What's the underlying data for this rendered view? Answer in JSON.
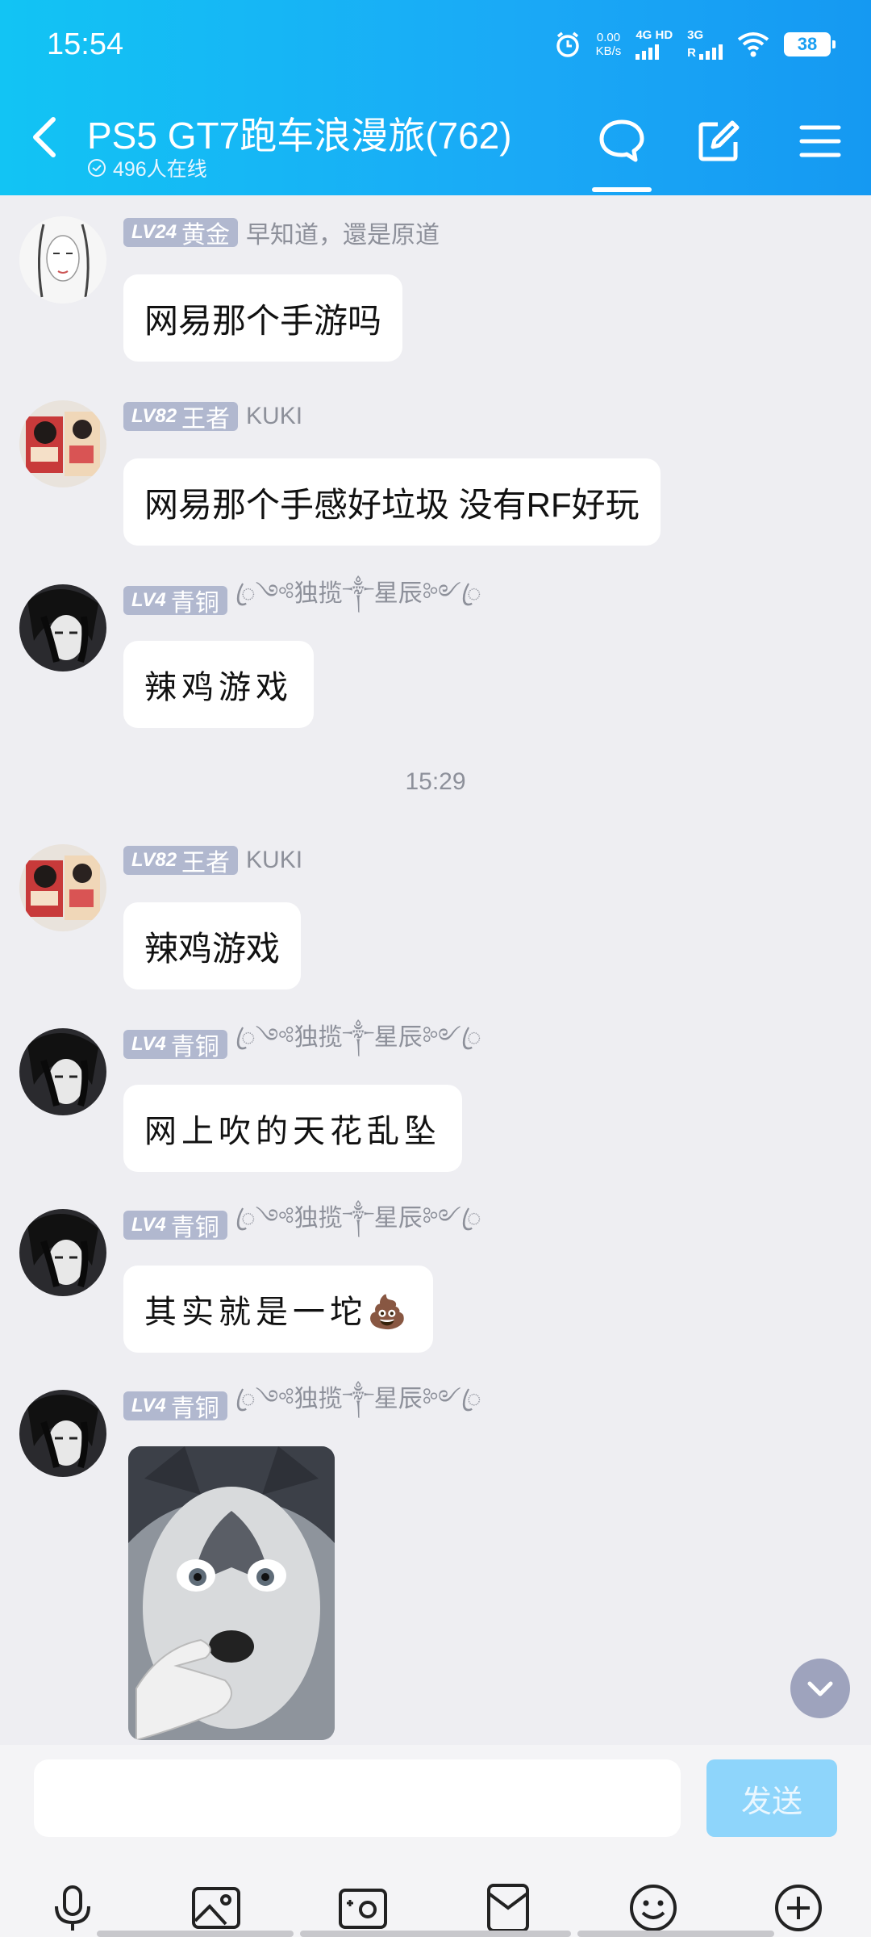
{
  "status_bar": {
    "time": "15:54",
    "net_speed": "0.00",
    "net_unit": "KB/s",
    "sim1": "4G HD",
    "sim2": "3G",
    "sim2_roaming": "R",
    "battery": "38"
  },
  "header": {
    "title": "PS5 GT7跑车浪漫旅(762)",
    "online": "496人在线"
  },
  "messages": [
    {
      "level": "LV24",
      "rank": "黄金",
      "nick": "早知道，還是原道",
      "text": "网易那个手游吗",
      "avatar": "sketch-portrait"
    },
    {
      "level": "LV82",
      "rank": "王者",
      "nick": "KUKI",
      "text": "网易那个手感好垃圾  没有RF好玩",
      "avatar": "anime-collage"
    },
    {
      "level": "LV4",
      "rank": "青铜",
      "nick": "ꦿ༺独揽༒星辰༻ꦿ",
      "text": "辣鸡游戏",
      "avatar": "dark-anime"
    },
    {
      "level": "LV82",
      "rank": "王者",
      "nick": "KUKI",
      "text": "辣鸡游戏",
      "avatar": "anime-collage"
    },
    {
      "level": "LV4",
      "rank": "青铜",
      "nick": "ꦿ༺独揽༒星辰༻ꦿ",
      "text": "网上吹的天花乱坠",
      "avatar": "dark-anime"
    },
    {
      "level": "LV4",
      "rank": "青铜",
      "nick": "ꦿ༺独揽༒星辰༻ꦿ",
      "text": "其实就是一坨💩",
      "avatar": "dark-anime"
    },
    {
      "level": "LV4",
      "rank": "青铜",
      "nick": "ꦿ༺独揽༒星辰༻ꦿ",
      "image": "husky-pointing-meme",
      "avatar": "dark-anime"
    }
  ],
  "time_separator": "15:29",
  "composer": {
    "placeholder": "",
    "send_label": "发送"
  },
  "colors": {
    "header_gradient_start": "#12c4f4",
    "header_gradient_end": "#1599f2",
    "badge": "#b1b8cf",
    "send_disabled": "#8ed5fb",
    "background": "#eeeef2"
  }
}
